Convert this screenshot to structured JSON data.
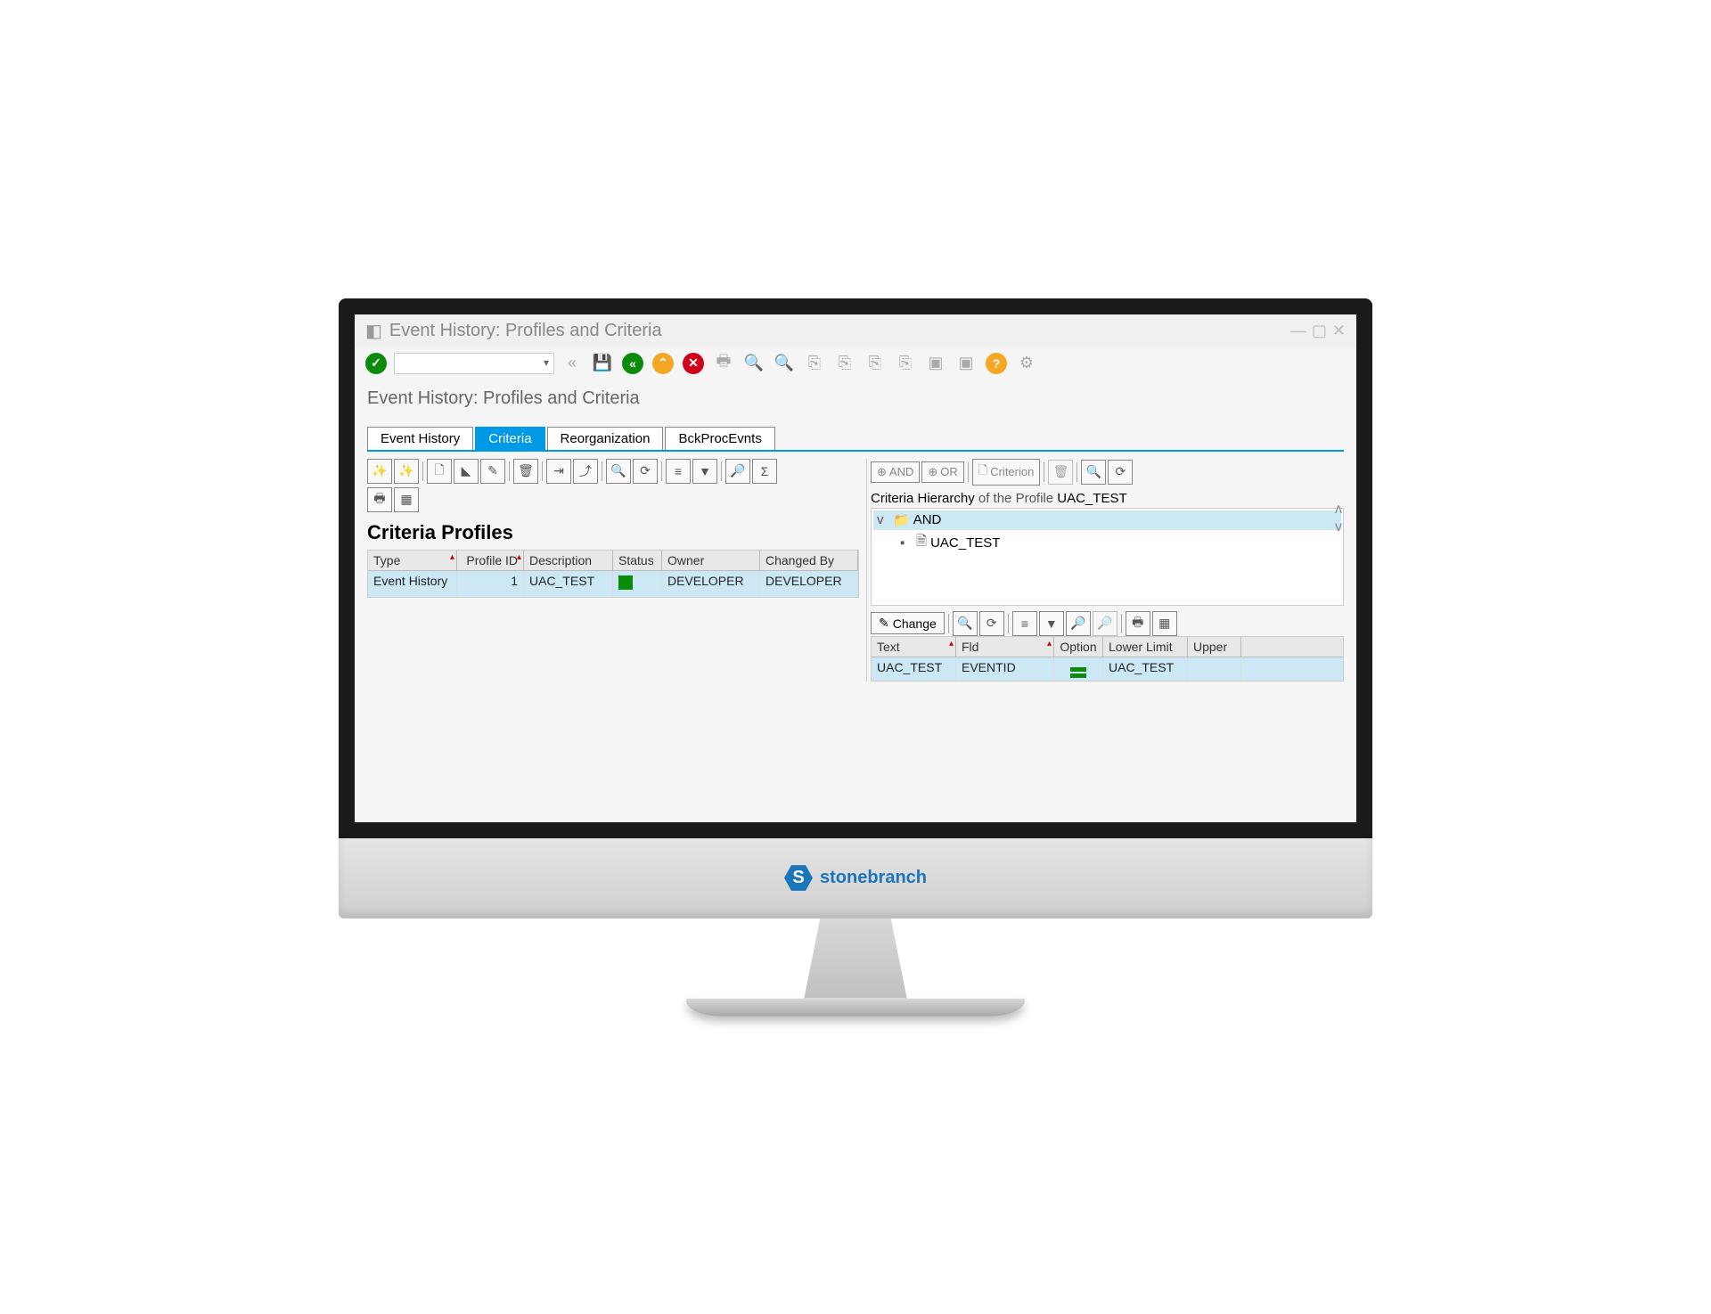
{
  "window": {
    "title": "Event History: Profiles and Criteria"
  },
  "page_title": "Event History: Profiles and Criteria",
  "tabs": [
    {
      "label": "Event History"
    },
    {
      "label": "Criteria"
    },
    {
      "label": "Reorganization"
    },
    {
      "label": "BckProcEvnts"
    }
  ],
  "left": {
    "section_title": "Criteria Profiles",
    "columns": {
      "type": "Type",
      "profile_id": "Profile ID",
      "description": "Description",
      "status": "Status",
      "owner": "Owner",
      "changed_by": "Changed By"
    },
    "rows": [
      {
        "type": "Event History",
        "profile_id": "1",
        "description": "UAC_TEST",
        "status": "green",
        "owner": "DEVELOPER",
        "changed_by": "DEVELOPER"
      }
    ]
  },
  "right": {
    "and_label": "AND",
    "or_label": "OR",
    "criterion_label": "Criterion",
    "hier_prefix": "Criteria Hierarchy",
    "hier_mid": " of the Profile ",
    "hier_profile": "UAC_TEST",
    "tree": {
      "root": "AND",
      "child": "UAC_TEST"
    },
    "change_label": "Change",
    "grid2": {
      "columns": {
        "text": "Text",
        "fld": "Fld",
        "option": "Option",
        "lower": "Lower Limit",
        "upper": "Upper"
      },
      "rows": [
        {
          "text": "UAC_TEST",
          "fld": "EVENTID",
          "option": "=",
          "lower": "UAC_TEST",
          "upper": ""
        }
      ]
    }
  },
  "brand": {
    "letter": "S",
    "name": "stonebranch"
  }
}
